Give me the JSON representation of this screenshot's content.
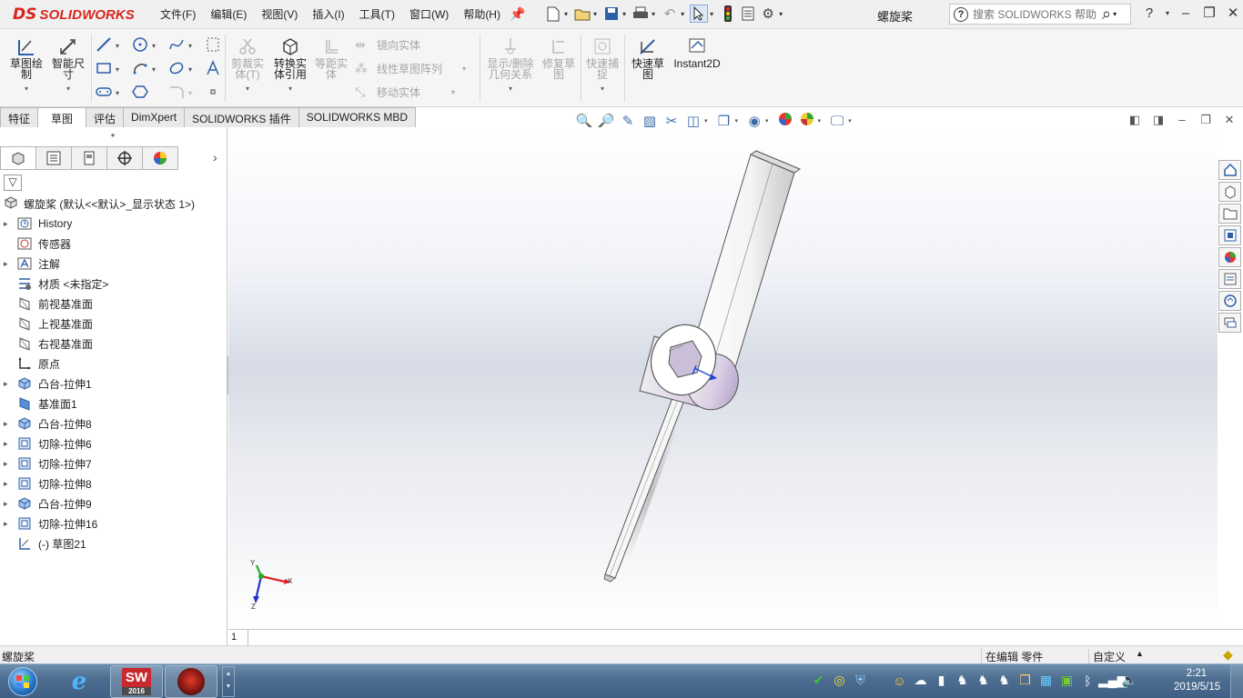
{
  "app": {
    "logo_ds": "DS",
    "logo_solid": "SOLID",
    "logo_works": "WORKS",
    "doc_title": "螺旋桨",
    "brand_color": "#d9261c"
  },
  "menu": [
    "文件(F)",
    "编辑(E)",
    "视图(V)",
    "插入(I)",
    "工具(T)",
    "窗口(W)",
    "帮助(H)"
  ],
  "search": {
    "placeholder": "搜索 SOLIDWORKS 帮助",
    "help_glyph": "?"
  },
  "ribbon": {
    "sketch": "草图绘\n制",
    "smart_dim": "智能尺\n寸",
    "trim": "剪裁实\n体(T)",
    "convert": "转换实\n体引用",
    "offset": "等距实\n体",
    "mirror": "镜向实体",
    "linear_pattern": "线性草图阵列",
    "move": "移动实体",
    "display_delete": "显示/删除\n几何关系",
    "repair": "修复草\n图",
    "quick_snaps": "快速捕\n捉",
    "rapid_sketch": "快速草\n图",
    "instant2d": "Instant2D"
  },
  "tabs": [
    {
      "label": "特征",
      "active": false
    },
    {
      "label": "草图",
      "active": true
    },
    {
      "label": "评估",
      "active": false
    },
    {
      "label": "DimXpert",
      "active": false
    },
    {
      "label": "SOLIDWORKS 插件",
      "active": false
    },
    {
      "label": "SOLIDWORKS MBD",
      "active": false
    }
  ],
  "tree": {
    "root": "螺旋桨 (默认<<默认>_显示状态 1>)",
    "items": [
      {
        "label": "History",
        "icon": "history-icon",
        "expandable": true
      },
      {
        "label": "传感器",
        "icon": "sensor-icon",
        "expandable": false
      },
      {
        "label": "注解",
        "icon": "annotation-icon",
        "expandable": true
      },
      {
        "label": "材质 <未指定>",
        "icon": "material-icon",
        "expandable": false
      },
      {
        "label": "前视基准面",
        "icon": "plane-icon",
        "expandable": false
      },
      {
        "label": "上视基准面",
        "icon": "plane-icon",
        "expandable": false
      },
      {
        "label": "右视基准面",
        "icon": "plane-icon",
        "expandable": false
      },
      {
        "label": "原点",
        "icon": "origin-icon",
        "expandable": false
      },
      {
        "label": "凸台-拉伸1",
        "icon": "boss-extrude-icon",
        "expandable": true
      },
      {
        "label": "基准面1",
        "icon": "plane-blue-icon",
        "expandable": false
      },
      {
        "label": "凸台-拉伸8",
        "icon": "boss-extrude-icon",
        "expandable": true
      },
      {
        "label": "切除-拉伸6",
        "icon": "cut-extrude-icon",
        "expandable": true
      },
      {
        "label": "切除-拉伸7",
        "icon": "cut-extrude-icon",
        "expandable": true
      },
      {
        "label": "切除-拉伸8",
        "icon": "cut-extrude-icon",
        "expandable": true
      },
      {
        "label": "凸台-拉伸9",
        "icon": "boss-extrude-icon",
        "expandable": true
      },
      {
        "label": "切除-拉伸16",
        "icon": "cut-extrude-icon",
        "expandable": true
      },
      {
        "label": "(-) 草图21",
        "icon": "sketch-icon",
        "expandable": false
      }
    ]
  },
  "triad": {
    "x": "X",
    "y": "Y",
    "z": "Z"
  },
  "sheet": {
    "page": "1"
  },
  "status": {
    "left": "螺旋桨",
    "mode": "在编辑 零件",
    "units": "自定义"
  },
  "taskbar": {
    "sw_label": "SW",
    "sw_version": "2016",
    "time": "2:21",
    "date": "2019/5/15"
  }
}
